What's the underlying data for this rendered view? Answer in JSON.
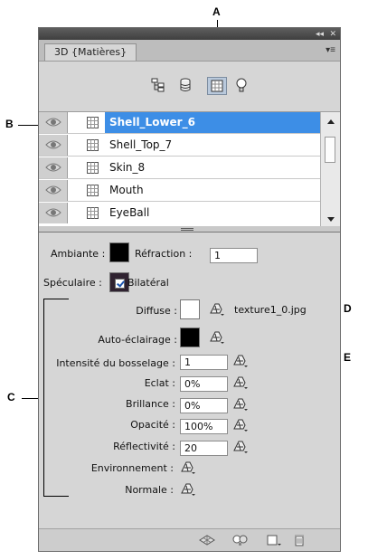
{
  "callouts": {
    "a": "A",
    "b": "B",
    "c": "C",
    "d": "D",
    "e": "E"
  },
  "panel": {
    "tab_label": "3D {Matières}",
    "collapse_glyph": "◂◂",
    "close_glyph": "✕",
    "menu_glyph": "▾≡",
    "toolbar_icons": [
      "scene-icon",
      "mesh-icon",
      "materials-icon",
      "light-bulb-icon"
    ],
    "selected_tool": "materials-icon"
  },
  "materials": {
    "items": [
      {
        "label": "Shell_Lower_6",
        "selected": true
      },
      {
        "label": "Shell_Top_7",
        "selected": false
      },
      {
        "label": "Skin_8",
        "selected": false
      },
      {
        "label": "Mouth",
        "selected": false
      },
      {
        "label": "EyeBall",
        "selected": false
      }
    ]
  },
  "props": {
    "ambiante_label": "Ambiante :",
    "ambiante_color": "#000000",
    "refraction_label": "Réfraction :",
    "refraction_value": "1",
    "speculaire_label": "Spéculaire :",
    "speculaire_color": "#2f2230",
    "bilateral_label": "Bilatéral",
    "bilateral_checked": true,
    "diffuse_label": "Diffuse :",
    "diffuse_color": "#ffffff",
    "diffuse_texture": "texture1_0.jpg",
    "auto_label": "Auto-éclairage :",
    "auto_color": "#000000",
    "bump_label": "Intensité du bosselage :",
    "bump_value": "1",
    "eclat_label": "Eclat :",
    "eclat_value": "0%",
    "brillance_label": "Brillance :",
    "brillance_value": "0%",
    "opacite_label": "Opacité :",
    "opacite_value": "100%",
    "reflect_label": "Réflectivité :",
    "reflect_value": "20",
    "env_label": "Environnement :",
    "normale_label": "Normale :"
  },
  "bottom_icons": [
    "render-icon",
    "snapshot-icon",
    "new-material-icon",
    "trash-icon"
  ],
  "colors": {
    "selection": "#3d8ee6",
    "panel_bg": "#d6d6d6"
  }
}
